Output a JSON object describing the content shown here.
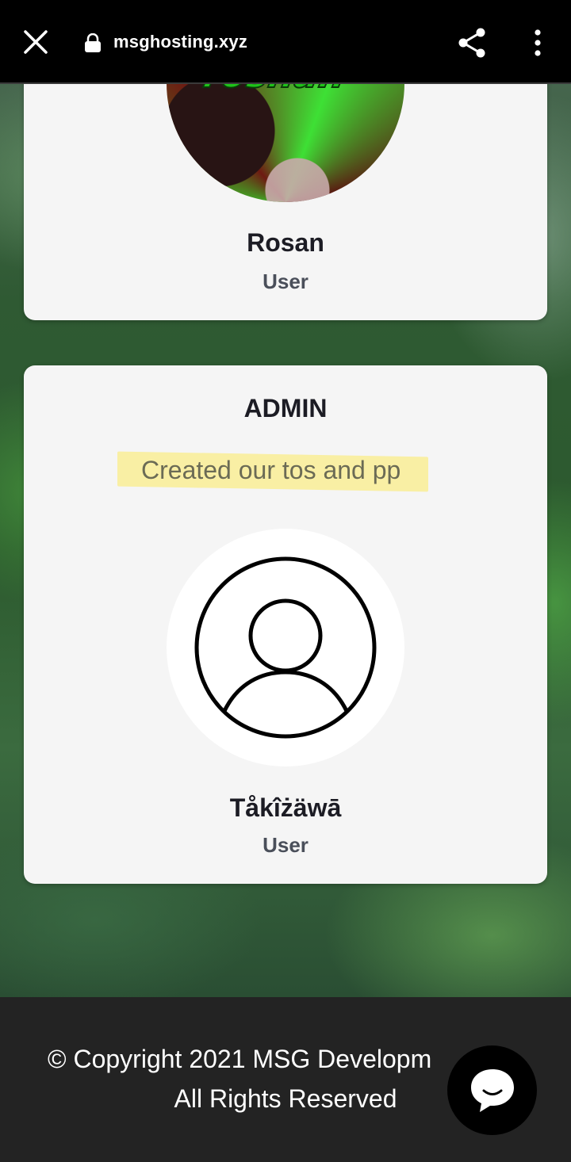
{
  "browser": {
    "url": "msghosting.xyz",
    "icons": {
      "close": "close-icon",
      "lock": "lock-icon",
      "share": "share-icon",
      "menu": "more-vert-icon"
    }
  },
  "cards": [
    {
      "avatar_text": "roshan",
      "name": "Rosan",
      "role": "User"
    },
    {
      "heading": "ADMIN",
      "description": "Created our tos and pp",
      "name": "Tåkîżäwā",
      "role": "User"
    }
  ],
  "footer": {
    "line1": "© Copyright 2021 MSG Developm",
    "line2": "All Rights Reserved"
  },
  "chat": {
    "icon": "chat-bubble-icon"
  },
  "colors": {
    "topbar": "#000000",
    "card": "#f5f5f5",
    "footer": "#232323",
    "highlight": "#faeb78"
  }
}
